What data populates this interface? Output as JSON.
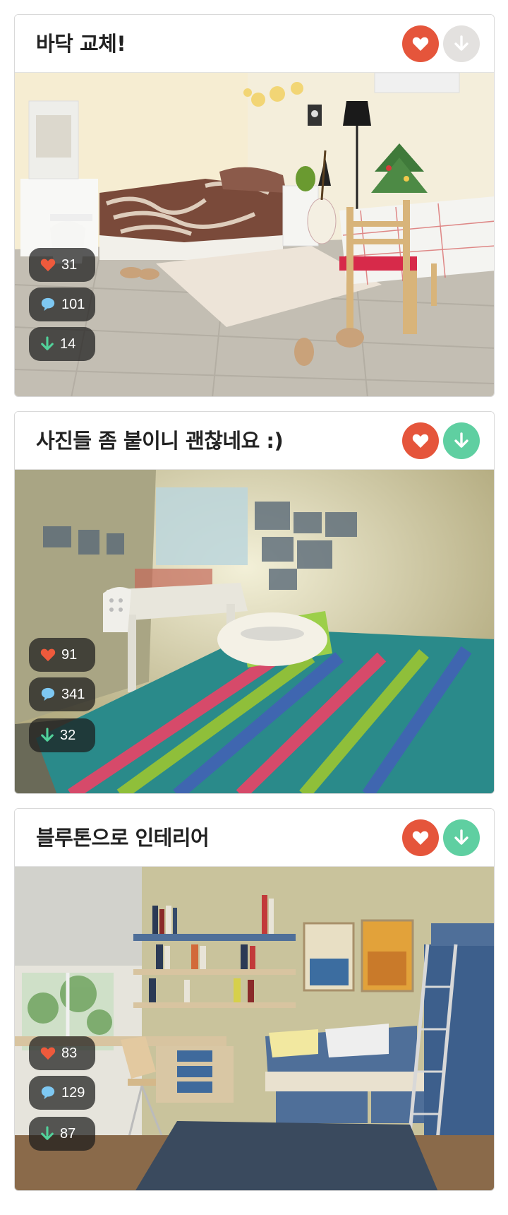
{
  "posts": [
    {
      "title": "바닥 교체!",
      "likes": "31",
      "comments": "101",
      "downloads": "14",
      "download_active": false,
      "icons": {
        "like": "heart-icon",
        "download": "arrow-down-icon",
        "comment": "speech-bubble-icon"
      }
    },
    {
      "title": "사진들 좀 붙이니 괜찮네요 :)",
      "likes": "91",
      "comments": "341",
      "downloads": "32",
      "download_active": true,
      "icons": {
        "like": "heart-icon",
        "download": "arrow-down-icon",
        "comment": "speech-bubble-icon"
      }
    },
    {
      "title": "블루톤으로 인테리어",
      "likes": "83",
      "comments": "129",
      "downloads": "87",
      "download_active": true,
      "icons": {
        "like": "heart-icon",
        "download": "arrow-down-icon",
        "comment": "speech-bubble-icon"
      }
    }
  ],
  "colors": {
    "like": "#e5553b",
    "download_active": "#5fcfa1",
    "download_inactive": "#e3e1df",
    "comment": "#7ec8f2",
    "stat_heart": "#ee5a3c",
    "stat_arrow": "#52d19a"
  }
}
